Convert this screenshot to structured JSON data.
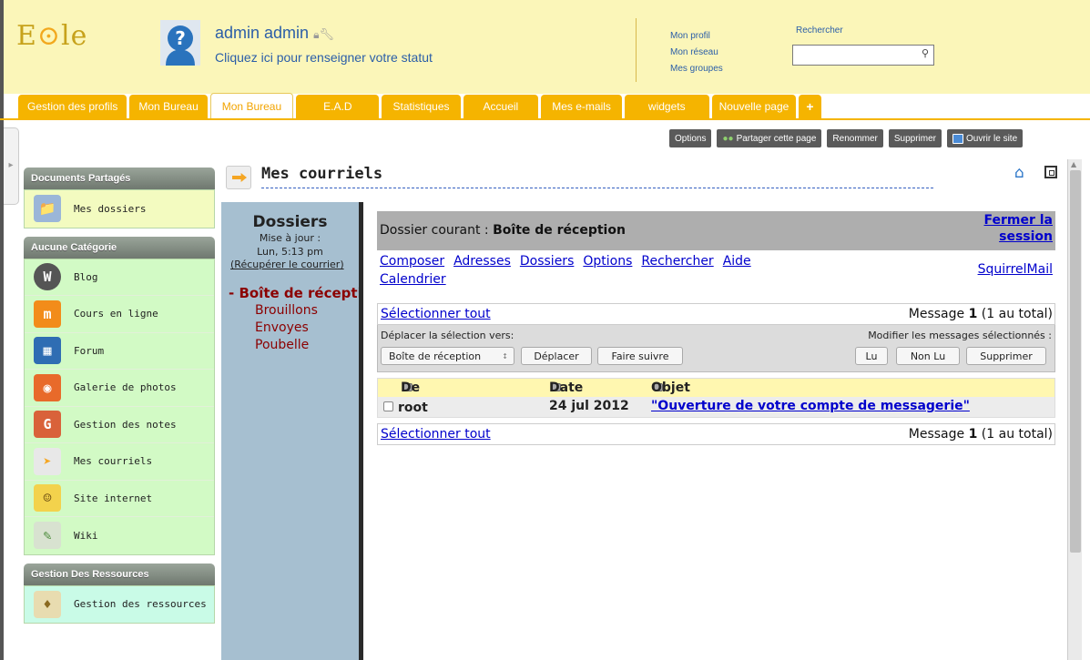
{
  "header": {
    "logo": "EOLE",
    "username": "admin admin",
    "status_prompt": "Cliquez ici pour renseigner votre statut",
    "profile_links": [
      "Mon profil",
      "Mon réseau",
      "Mes groupes"
    ],
    "search_label": "Rechercher",
    "search_value": ""
  },
  "tabs": [
    {
      "label": "Gestion des profils"
    },
    {
      "label": "Mon Bureau"
    },
    {
      "label": "Mon Bureau",
      "active": true
    },
    {
      "label": "E.A.D"
    },
    {
      "label": "Statistiques"
    },
    {
      "label": "Accueil"
    },
    {
      "label": "Mes e-mails"
    },
    {
      "label": "widgets"
    },
    {
      "label": "Nouvelle page"
    },
    {
      "label": "+"
    }
  ],
  "page_actions": [
    "Options",
    "Partager cette page",
    "Renommer",
    "Supprimer",
    "Ouvrir le site"
  ],
  "sidebar": {
    "groups": [
      {
        "title": "Documents Partagés",
        "items": [
          {
            "label": "Mes dossiers",
            "icon": "folder-icon"
          }
        ]
      },
      {
        "title": "Aucune Catégorie",
        "items": [
          {
            "label": "Blog",
            "icon": "wordpress-icon"
          },
          {
            "label": "Cours en ligne",
            "icon": "moodle-icon"
          },
          {
            "label": "Forum",
            "icon": "forum-icon"
          },
          {
            "label": "Galerie de photos",
            "icon": "camera-icon"
          },
          {
            "label": "Gestion des notes",
            "icon": "notes-icon"
          },
          {
            "label": "Mes courriels",
            "icon": "mail-arrow-icon"
          },
          {
            "label": "Site internet",
            "icon": "website-icon"
          },
          {
            "label": "Wiki",
            "icon": "wiki-icon"
          }
        ]
      },
      {
        "title": "Gestion Des Ressources",
        "items": [
          {
            "label": "Gestion des ressources",
            "icon": "resources-icon"
          }
        ]
      }
    ]
  },
  "widget": {
    "title": "Mes courriels"
  },
  "webmail": {
    "folders_title": "Dossiers",
    "updated_label": "Mise à jour :",
    "updated_time": "Lun, 5:13 pm",
    "fetch_link": "(Récupérer le courrier)",
    "folders": [
      "Boîte de réception",
      "Brouillons",
      "Envoyes",
      "Poubelle"
    ],
    "current_folder_label": "Dossier courant :",
    "current_folder": "Boîte de réception",
    "logout_line1": "Fermer la",
    "logout_line2": "session",
    "nav_links": [
      "Composer",
      "Adresses",
      "Dossiers",
      "Options",
      "Rechercher",
      "Aide",
      "Calendrier"
    ],
    "brand_link": "SquirrelMail",
    "select_all": "Sélectionner tout",
    "message_count_prefix": "Message",
    "message_count_num": "1",
    "message_count_suffix": "(1 au total)",
    "move_label": "Déplacer la sélection vers:",
    "modify_label": "Modifier les messages sélectionnés :",
    "move_target": "Boîte de réception",
    "move_button": "Déplacer",
    "forward_button": "Faire suivre",
    "read_button": "Lu",
    "unread_button": "Non Lu",
    "delete_button": "Supprimer",
    "columns": [
      "De",
      "Date",
      "Objet"
    ],
    "messages": [
      {
        "from": "root",
        "date": "24 jul 2012",
        "subject": "\"Ouverture de votre compte de messagerie\""
      }
    ]
  },
  "colors": {
    "tab": "#f5b400",
    "header": "#fbf6b9",
    "folder_pane": "#a6bfd0",
    "link": "#0000cc"
  }
}
